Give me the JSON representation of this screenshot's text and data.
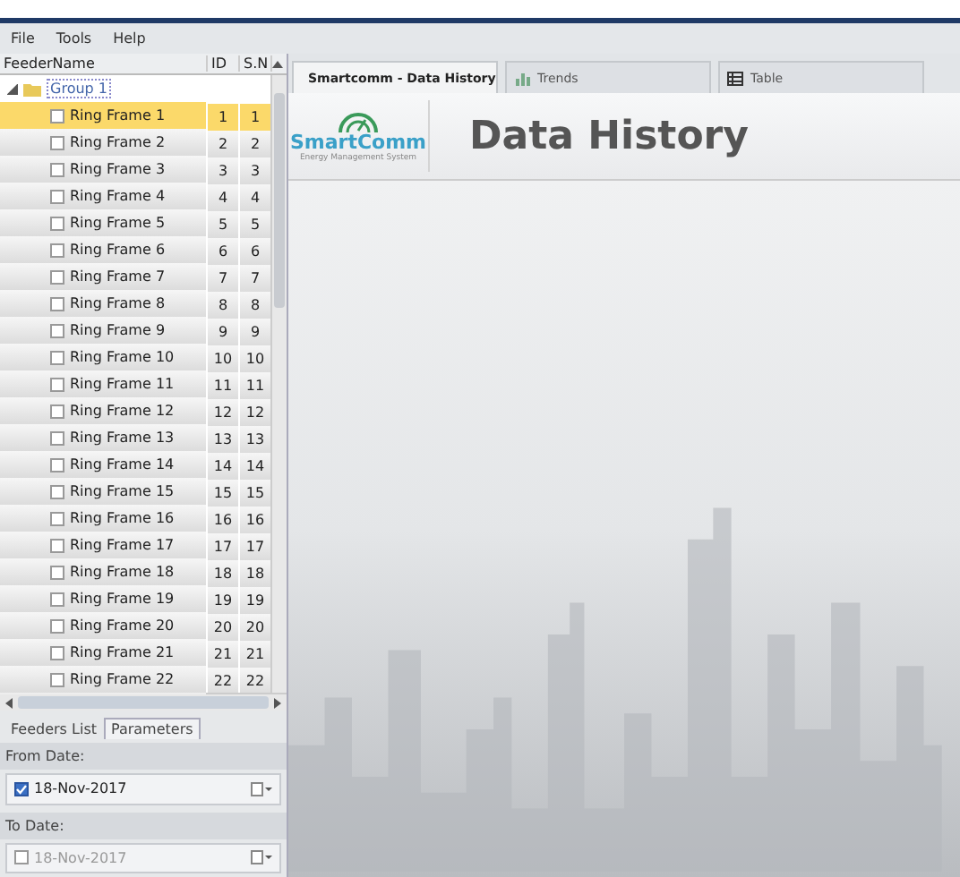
{
  "menu": [
    "File",
    "Tools",
    "Help"
  ],
  "tree": {
    "columns": [
      "FeederName",
      "ID",
      "S.N"
    ],
    "groups": [
      {
        "label": "Group 1",
        "expanded": true,
        "children": [
          {
            "name": "Ring Frame 1",
            "id": "1",
            "sn": "1",
            "checked": false,
            "selected": true
          },
          {
            "name": "Ring Frame 2",
            "id": "2",
            "sn": "2",
            "checked": false,
            "selected": false
          },
          {
            "name": "Ring Frame 3",
            "id": "3",
            "sn": "3",
            "checked": false,
            "selected": false
          },
          {
            "name": "Ring Frame 4",
            "id": "4",
            "sn": "4",
            "checked": false,
            "selected": false
          },
          {
            "name": "Ring Frame 5",
            "id": "5",
            "sn": "5",
            "checked": false,
            "selected": false
          },
          {
            "name": "Ring Frame 6",
            "id": "6",
            "sn": "6",
            "checked": false,
            "selected": false
          },
          {
            "name": "Ring Frame 7",
            "id": "7",
            "sn": "7",
            "checked": false,
            "selected": false
          },
          {
            "name": "Ring Frame 8",
            "id": "8",
            "sn": "8",
            "checked": false,
            "selected": false
          },
          {
            "name": "Ring Frame 9",
            "id": "9",
            "sn": "9",
            "checked": false,
            "selected": false
          },
          {
            "name": "Ring Frame 10",
            "id": "10",
            "sn": "10",
            "checked": false,
            "selected": false
          },
          {
            "name": "Ring Frame 11",
            "id": "11",
            "sn": "11",
            "checked": false,
            "selected": false
          },
          {
            "name": "Ring Frame 12",
            "id": "12",
            "sn": "12",
            "checked": false,
            "selected": false
          },
          {
            "name": "Ring Frame 13",
            "id": "13",
            "sn": "13",
            "checked": false,
            "selected": false
          },
          {
            "name": "Ring Frame 14",
            "id": "14",
            "sn": "14",
            "checked": false,
            "selected": false
          },
          {
            "name": "Ring Frame 15",
            "id": "15",
            "sn": "15",
            "checked": false,
            "selected": false
          },
          {
            "name": "Ring Frame 16",
            "id": "16",
            "sn": "16",
            "checked": false,
            "selected": false
          },
          {
            "name": "Ring Frame 17",
            "id": "17",
            "sn": "17",
            "checked": false,
            "selected": false
          },
          {
            "name": "Ring Frame 18",
            "id": "18",
            "sn": "18",
            "checked": false,
            "selected": false
          },
          {
            "name": "Ring Frame 19",
            "id": "19",
            "sn": "19",
            "checked": false,
            "selected": false
          },
          {
            "name": "Ring Frame 20",
            "id": "20",
            "sn": "20",
            "checked": false,
            "selected": false
          },
          {
            "name": "Ring Frame 21",
            "id": "21",
            "sn": "21",
            "checked": false,
            "selected": false
          },
          {
            "name": "Ring Frame 22",
            "id": "22",
            "sn": "22",
            "checked": false,
            "selected": false
          }
        ]
      }
    ]
  },
  "panel_tabs": [
    {
      "label": "Feeders List",
      "selected": false
    },
    {
      "label": "Parameters",
      "selected": true
    }
  ],
  "from_date": {
    "label": "From Date:",
    "value": "18-Nov-2017",
    "checked": true,
    "disabled": false
  },
  "to_date": {
    "label": "To Date:",
    "value": "18-Nov-2017",
    "checked": false,
    "disabled": true
  },
  "doc_tabs": [
    {
      "label": "Smartcomm - Data History",
      "selected": true
    },
    {
      "label": "Trends",
      "selected": false
    },
    {
      "label": "Table",
      "selected": false
    }
  ],
  "header": {
    "brand": "SmartComm",
    "tagline": "Energy Management System",
    "title": "Data History"
  }
}
